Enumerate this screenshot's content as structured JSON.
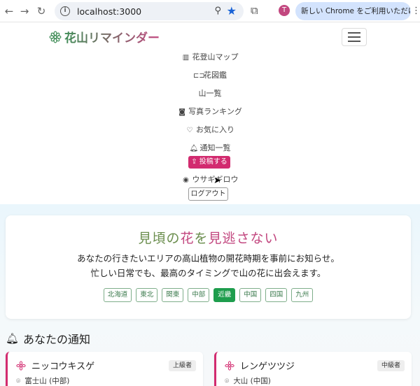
{
  "browser": {
    "url": "localhost:3000",
    "avatar_letter": "T",
    "update_label": "新しい Chrome をご利用いただけます",
    "accent": "#1a63d6"
  },
  "navbar": {
    "brand": "花山リマインダー",
    "brand_color": "#3f8c56",
    "items": [
      {
        "label": "花登山マップ",
        "icon": "map-icon"
      },
      {
        "label": "花図鑑",
        "icon": "book-icon"
      },
      {
        "label": "山一覧",
        "icon": ""
      },
      {
        "label": "写真ランキング",
        "icon": "camera-icon"
      },
      {
        "label": "お気に入り",
        "icon": "heart-icon"
      },
      {
        "label": "通知一覧",
        "icon": "bell-icon"
      }
    ],
    "post_label": "投稿する",
    "user_label": "ウサギギロウ",
    "logout_label": "ログアウト",
    "post_color": "#d22b6f"
  },
  "hero": {
    "title_a": "見頃の",
    "title_b": "花",
    "title_c": "を",
    "title_d": "見逃さない",
    "line1": "あなたの行きたいエリアの高山植物の開花時期を事前にお知らせ。",
    "line2": "忙しい日常でも、最高のタイミングで山の花に出会えます。",
    "regions": [
      "北海道",
      "東北",
      "関東",
      "中部",
      "近畿",
      "中国",
      "四国",
      "九州"
    ],
    "active_region": "近畿"
  },
  "notifications": {
    "title": "あなたの通知",
    "cards": [
      {
        "name": "ニッコウキスゲ",
        "badge": "上級者",
        "location": "富士山 (中部)"
      },
      {
        "name": "レンゲツツジ",
        "badge": "中級者",
        "location": "大山 (中国)"
      }
    ]
  }
}
